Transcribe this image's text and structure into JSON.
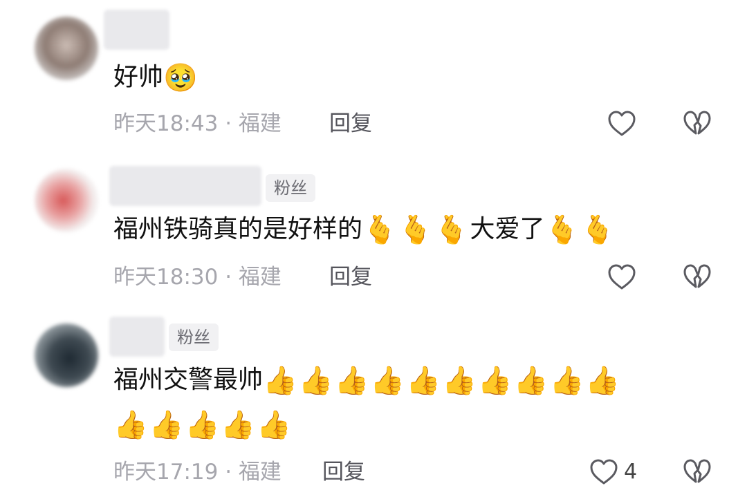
{
  "comments": [
    {
      "fan_badge": "",
      "text": "好帅",
      "emojis": "🥹",
      "emojis_line2": "",
      "time": "昨天18:43",
      "separator": "·",
      "location": "福建",
      "reply_label": "回复",
      "like_count": ""
    },
    {
      "fan_badge": "粉丝",
      "text": "福州铁骑真的是好样的",
      "emojis": "🫰🫰🫰",
      "text_after": "大爱了",
      "emojis_after": "🫰🫰",
      "emojis_line2": "",
      "time": "昨天18:30",
      "separator": "·",
      "location": "福建",
      "reply_label": "回复",
      "like_count": ""
    },
    {
      "fan_badge": "粉丝",
      "text": "福州交警最帅",
      "emojis": "👍👍👍👍👍👍👍👍👍👍",
      "emojis_line2": "👍👍👍👍👍",
      "time": "昨天17:19",
      "separator": "·",
      "location": "福建",
      "reply_label": "回复",
      "like_count": "4"
    }
  ],
  "icons": {
    "like": "heart-outline-icon",
    "dislike": "broken-heart-icon"
  },
  "colors": {
    "meta_text": "#a6a6ad",
    "icon_stroke": "#5a5a60",
    "fan_badge_bg": "#f1f1f3"
  }
}
